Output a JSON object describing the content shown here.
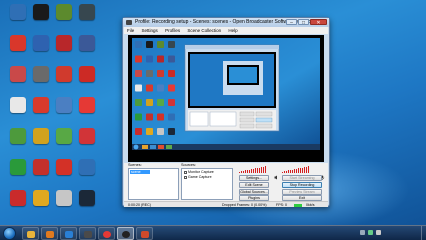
{
  "desktop": {
    "icons": [
      {
        "label": "",
        "color": "#2f6fb5"
      },
      {
        "label": "",
        "color": "#d9372b"
      },
      {
        "label": "",
        "color": "#c94949"
      },
      {
        "label": "",
        "color": "#e8e8e8"
      },
      {
        "label": "",
        "color": "#4d9a3c"
      },
      {
        "label": "",
        "color": "#2a9a3a"
      },
      {
        "label": "",
        "color": "#c92b2b"
      },
      {
        "label": "",
        "color": "#1a1a1a"
      },
      {
        "label": "",
        "color": "#2e62b0"
      },
      {
        "label": "",
        "color": "#6a6a6a"
      },
      {
        "label": "",
        "color": "#d83a2c"
      },
      {
        "label": "",
        "color": "#d1a21e"
      },
      {
        "label": "",
        "color": "#c4302b"
      },
      {
        "label": "",
        "color": "#e0a81f"
      },
      {
        "label": "",
        "color": "#5c8a2d"
      },
      {
        "label": "",
        "color": "#b8272a"
      },
      {
        "label": "",
        "color": "#d03a2d"
      },
      {
        "label": "",
        "color": "#4b7fc2"
      },
      {
        "label": "",
        "color": "#58a845"
      },
      {
        "label": "",
        "color": "#d33127"
      },
      {
        "label": "",
        "color": "#c6c6c6"
      },
      {
        "label": "",
        "color": "#37474f"
      },
      {
        "label": "",
        "color": "#3b5998"
      },
      {
        "label": "",
        "color": "#cc2a25"
      },
      {
        "label": "",
        "color": "#e53935"
      },
      {
        "label": "",
        "color": "#d13438"
      },
      {
        "label": "",
        "color": "#2f6fb5"
      },
      {
        "label": "",
        "color": "#1b2838"
      }
    ]
  },
  "window": {
    "title": "Profile: Recording setup - Scenes: scenes - Open Broadcaster Software v0.65b",
    "menu": [
      "File",
      "Settings",
      "Profiles",
      "Scene Collection",
      "Help"
    ],
    "scenes_label": "Scenes:",
    "sources_label": "Sources:",
    "scenes": [
      "scene"
    ],
    "sources": [
      "Monitor Capture",
      "Game Capture"
    ],
    "buttons": {
      "settings": "Settings...",
      "start_streaming": "Start Streaming",
      "edit_scene": "Edit Scene",
      "stop_recording": "Stop Recording",
      "global_sources": "Global Sources...",
      "preview_stream": "Preview Stream",
      "plugins": "Plugins",
      "exit": "Exit"
    },
    "status": {
      "time": "0:00:20 (REC)",
      "dropped": "Dropped Frames: 0 (0.00%)",
      "fps": "FPS: 0",
      "kbps": "0kb/s"
    }
  },
  "taskbar": {
    "clock": "",
    "date": ""
  },
  "colors": {
    "accent_red": "#d41f1f",
    "selection": "#3399ff"
  }
}
